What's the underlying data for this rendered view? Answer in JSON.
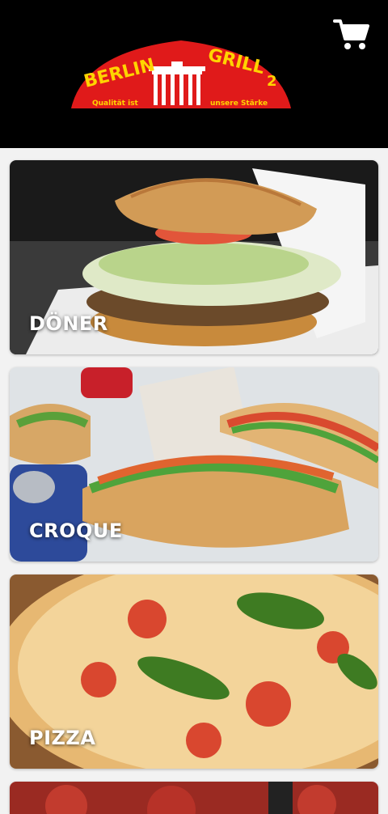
{
  "header": {
    "logo": {
      "line1": "BERLIN",
      "line2": "GRILL",
      "number": "2",
      "slogan_left": "Qualität ist",
      "slogan_right": "unsere Stärke"
    },
    "cart_icon": "shopping-cart-icon"
  },
  "categories": [
    {
      "label": "DÖNER"
    },
    {
      "label": "CROQUE"
    },
    {
      "label": "PIZZA"
    }
  ],
  "colors": {
    "header_bg": "#000000",
    "logo_red": "#e01a1a",
    "logo_yellow": "#ffd400",
    "page_bg": "#f2f2f2"
  }
}
